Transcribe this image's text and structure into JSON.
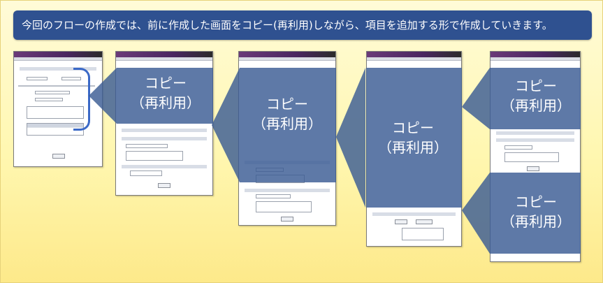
{
  "banner": {
    "text": "今回のフローの作成では、前に作成した画面をコピー(再利用)しながら、項目を追加する形で作成していきます。"
  },
  "copy_labels": [
    {
      "line1": "コピー",
      "line2": "（再利用）"
    },
    {
      "line1": "コピー",
      "line2": "（再利用）"
    },
    {
      "line1": "コピー",
      "line2": "（再利用）"
    },
    {
      "line1": "コピー",
      "line2": "（再利用）"
    },
    {
      "line1": "コピー",
      "line2": "（再利用）"
    }
  ],
  "colors": {
    "banner_bg": "#2f5190",
    "overlay": "#3a5c94",
    "bracket": "#3b69c7",
    "background": "#fff7b0"
  }
}
